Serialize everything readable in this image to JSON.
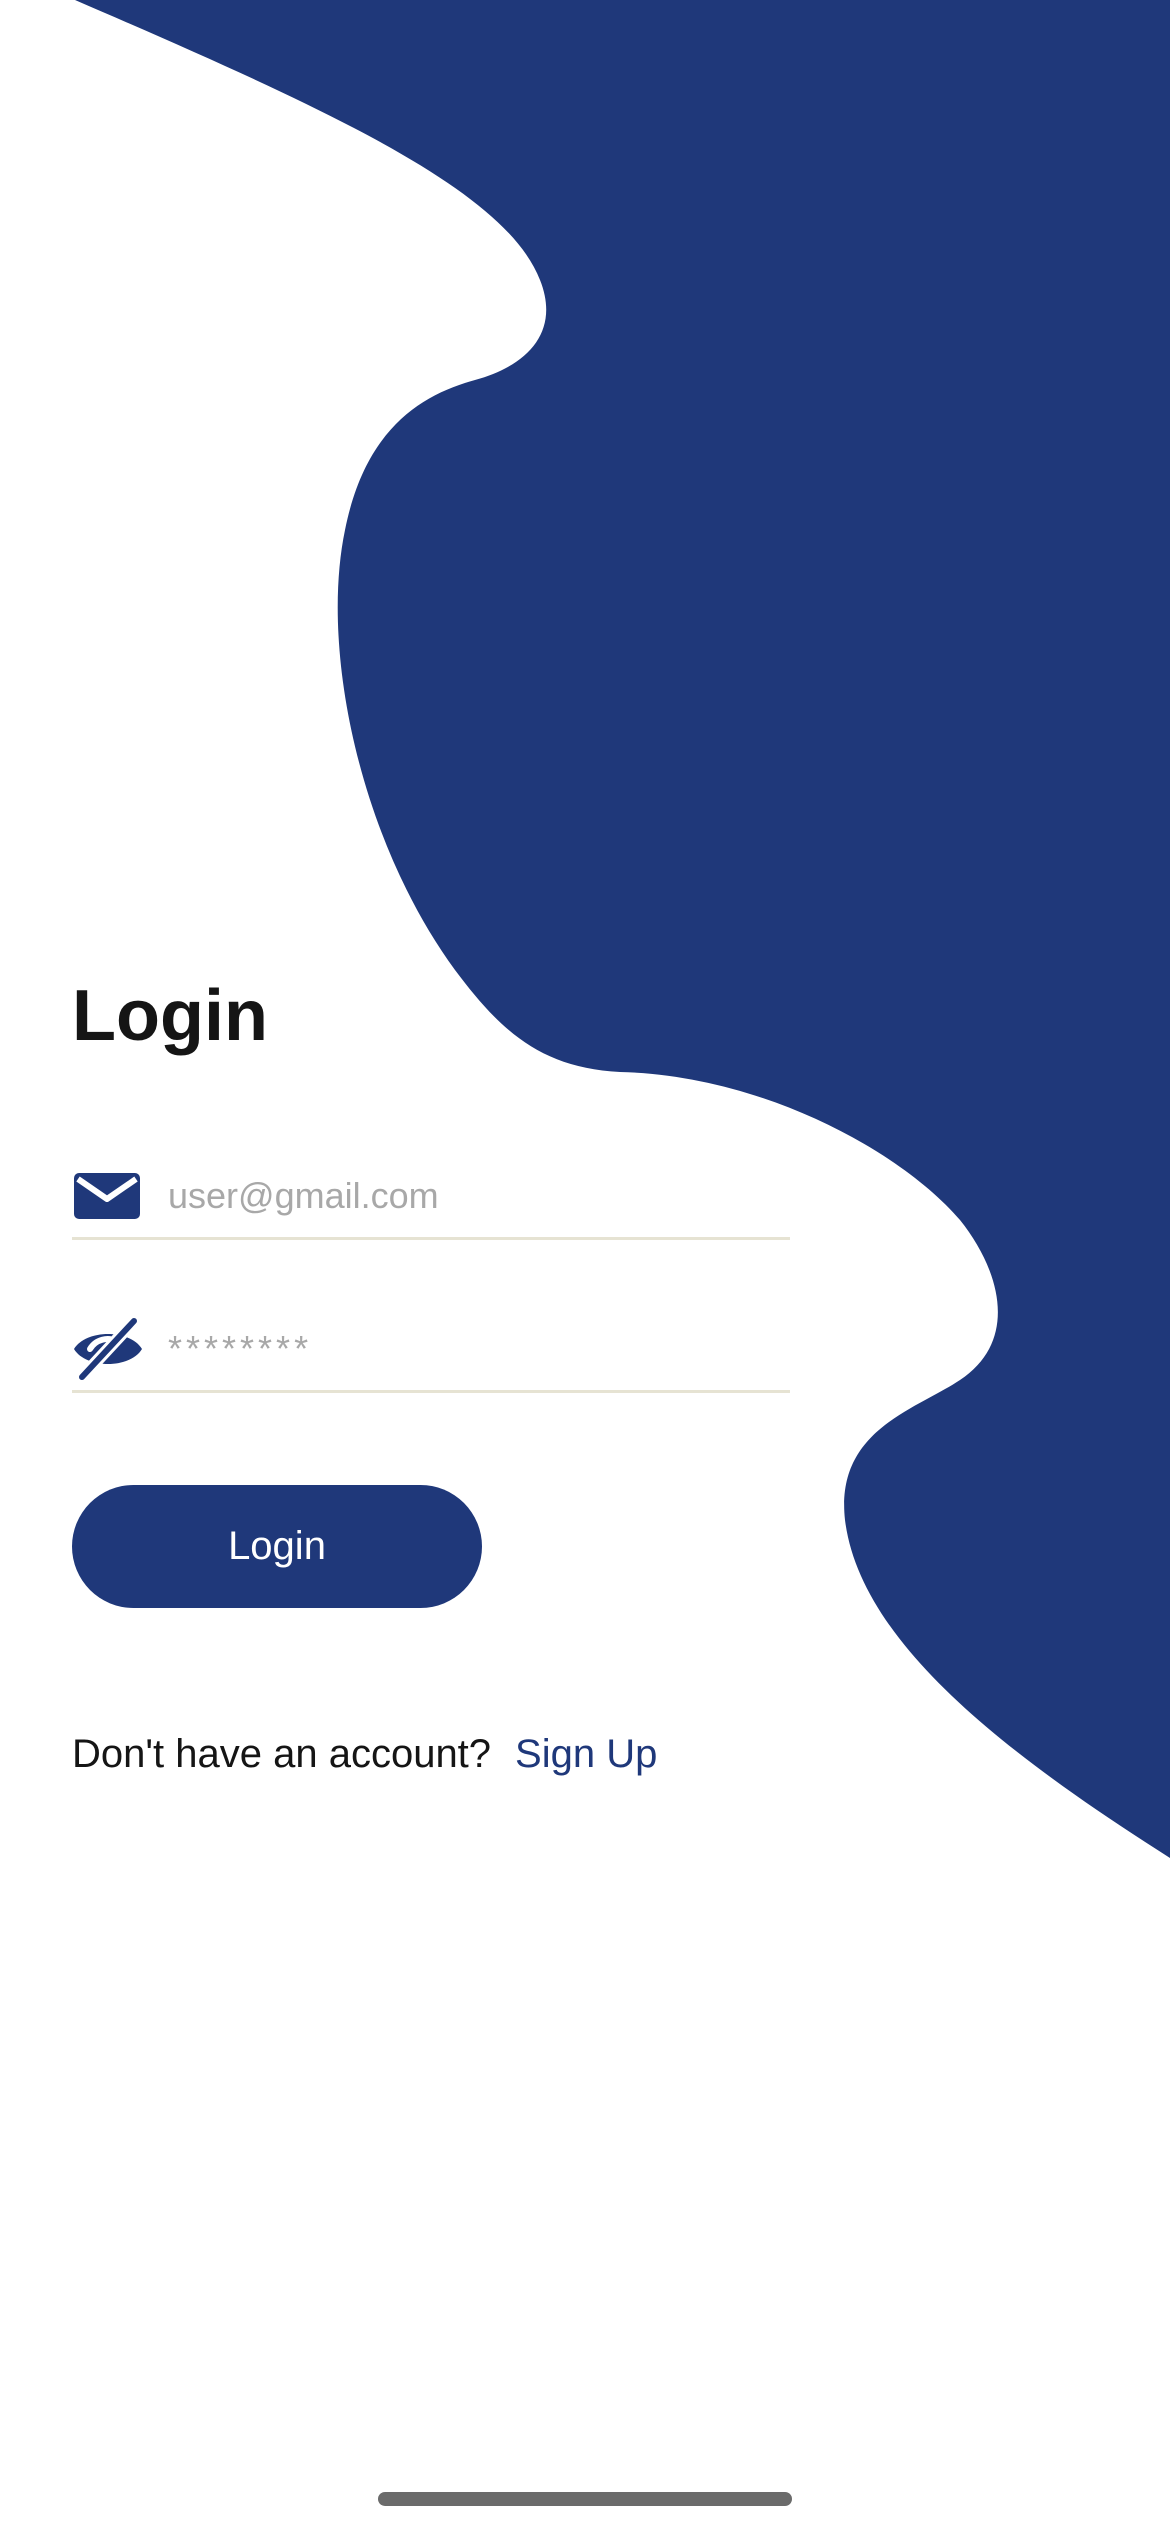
{
  "colors": {
    "brand": "#1f387a",
    "background": "#ffffff",
    "text": "#151515",
    "placeholder": "#a8a8a8",
    "divider": "#e6e3d3"
  },
  "login_form": {
    "title": "Login",
    "email_field": {
      "icon": "envelope-icon",
      "value": "",
      "placeholder": "user@gmail.com"
    },
    "password_field": {
      "icon": "eye-slash-icon",
      "value": "",
      "placeholder": "********"
    },
    "submit_label": "Login",
    "signup_prompt": "Don't have an account?",
    "signup_link": "Sign Up"
  }
}
